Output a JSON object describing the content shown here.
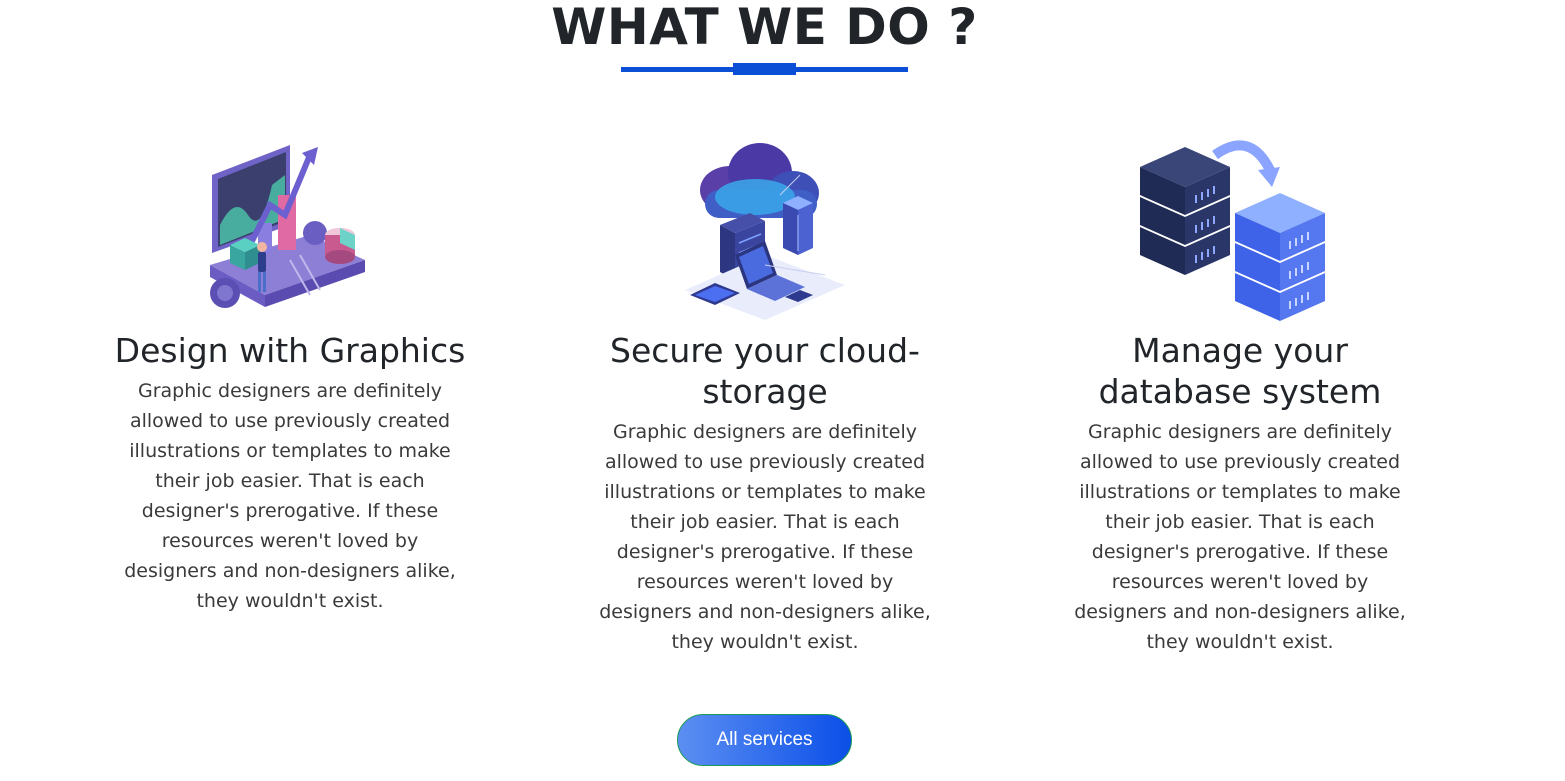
{
  "section": {
    "title": "WHAT WE DO ?"
  },
  "colors": {
    "accent": "#0a4fd6",
    "button_start": "#5c8ff2",
    "button_end": "#0b4fe8"
  },
  "cards": [
    {
      "icon": "design-graphics-illustration",
      "title": "Design with Graphics",
      "text": "Graphic designers are definitely allowed to use previously created illustrations or templates to make their job easier. That is each designer's prerogative. If these resources weren't loved by designers and non-designers alike, they wouldn't exist."
    },
    {
      "icon": "cloud-storage-illustration",
      "title": "Secure your cloud-storage",
      "text": "Graphic designers are definitely allowed to use previously created illustrations or templates to make their job easier. That is each designer's prerogative. If these resources weren't loved by designers and non-designers alike, they wouldn't exist."
    },
    {
      "icon": "database-servers-illustration",
      "title": "Manage your database system",
      "text": "Graphic designers are definitely allowed to use previously created illustrations or templates to make their job easier. That is each designer's prerogative. If these resources weren't loved by designers and non-designers alike, they wouldn't exist."
    }
  ],
  "cta": {
    "label": "All services"
  }
}
